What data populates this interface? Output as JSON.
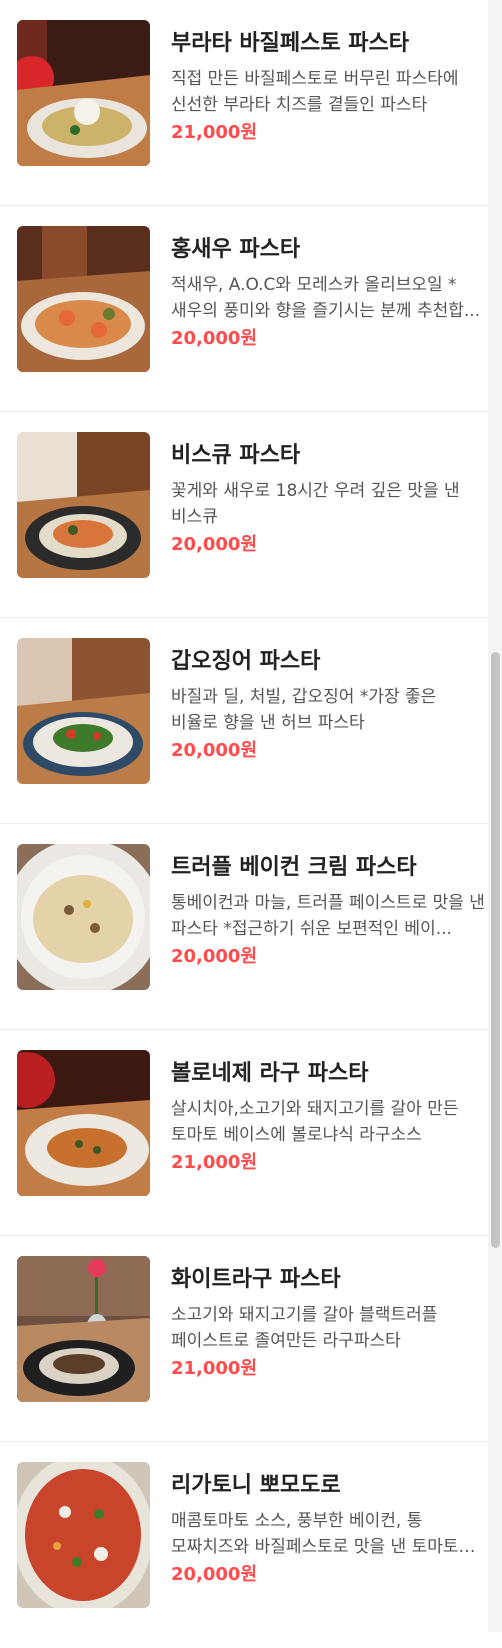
{
  "menu": {
    "items": [
      {
        "name": "부라타 바질페스토 파스타",
        "desc": "직접 만든 바질페스토로 버무린 파스타에 신선한 부라타 치즈를 곁들인 파스타",
        "price": "21,000원",
        "image": "burrata-basil-pasta-photo"
      },
      {
        "name": "홍새우 파스타",
        "desc": "적새우, A.O.C와 모레스카 올리브오일 *새우의 풍미와 향을 즐기시는 분께 추천합...",
        "price": "20,000원",
        "image": "red-shrimp-pasta-photo"
      },
      {
        "name": "비스큐 파스타",
        "desc": "꽃게와 새우로 18시간 우려 깊은 맛을 낸 비스큐",
        "price": "20,000원",
        "image": "bisque-pasta-photo"
      },
      {
        "name": "갑오징어 파스타",
        "desc": "바질과 딜, 처빌, 갑오징어 *가장 좋은 비율로 향을 낸 허브 파스타",
        "price": "20,000원",
        "image": "cuttlefish-pasta-photo"
      },
      {
        "name": "트러플 베이컨 크림 파스타",
        "desc": "통베이컨과 마늘, 트러플 페이스트로 맛을 낸 파스타 *접근하기 쉬운 보편적인 베이...",
        "price": "20,000원",
        "image": "truffle-bacon-cream-pasta-photo"
      },
      {
        "name": "볼로네제 라구 파스타",
        "desc": "살시치아,소고기와 돼지고기를 갈아 만든 토마토 베이스에 볼로냐식 라구소스",
        "price": "21,000원",
        "image": "bolognese-ragu-pasta-photo"
      },
      {
        "name": "화이트라구 파스타",
        "desc": "소고기와 돼지고기를 갈아 블랙트러플 페이스트로 졸여만든 라구파스타",
        "price": "21,000원",
        "image": "white-ragu-pasta-photo"
      },
      {
        "name": "리가토니 뽀모도로",
        "desc": "매콤토마토 소스, 풍부한 베이컨, 통 모짜치즈와 바질페스토로 맛을 낸 토마토 파스타",
        "price": "20,000원",
        "image": "rigatoni-pomodoro-photo"
      }
    ]
  },
  "colors": {
    "price": "#ff4b4b",
    "name": "#222222",
    "desc": "#555555"
  }
}
